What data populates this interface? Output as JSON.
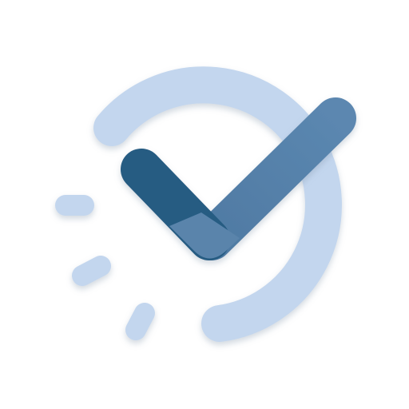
{
  "icon": {
    "name": "task-check-timer-icon",
    "description_label": "",
    "colors": {
      "ring": "#c3d6ee",
      "dashes": "#c3d6ee",
      "check_light": "#5a84ab",
      "check_dark": "#255b82",
      "shadow": "#9fb3c8",
      "background": "#ffffff"
    }
  }
}
